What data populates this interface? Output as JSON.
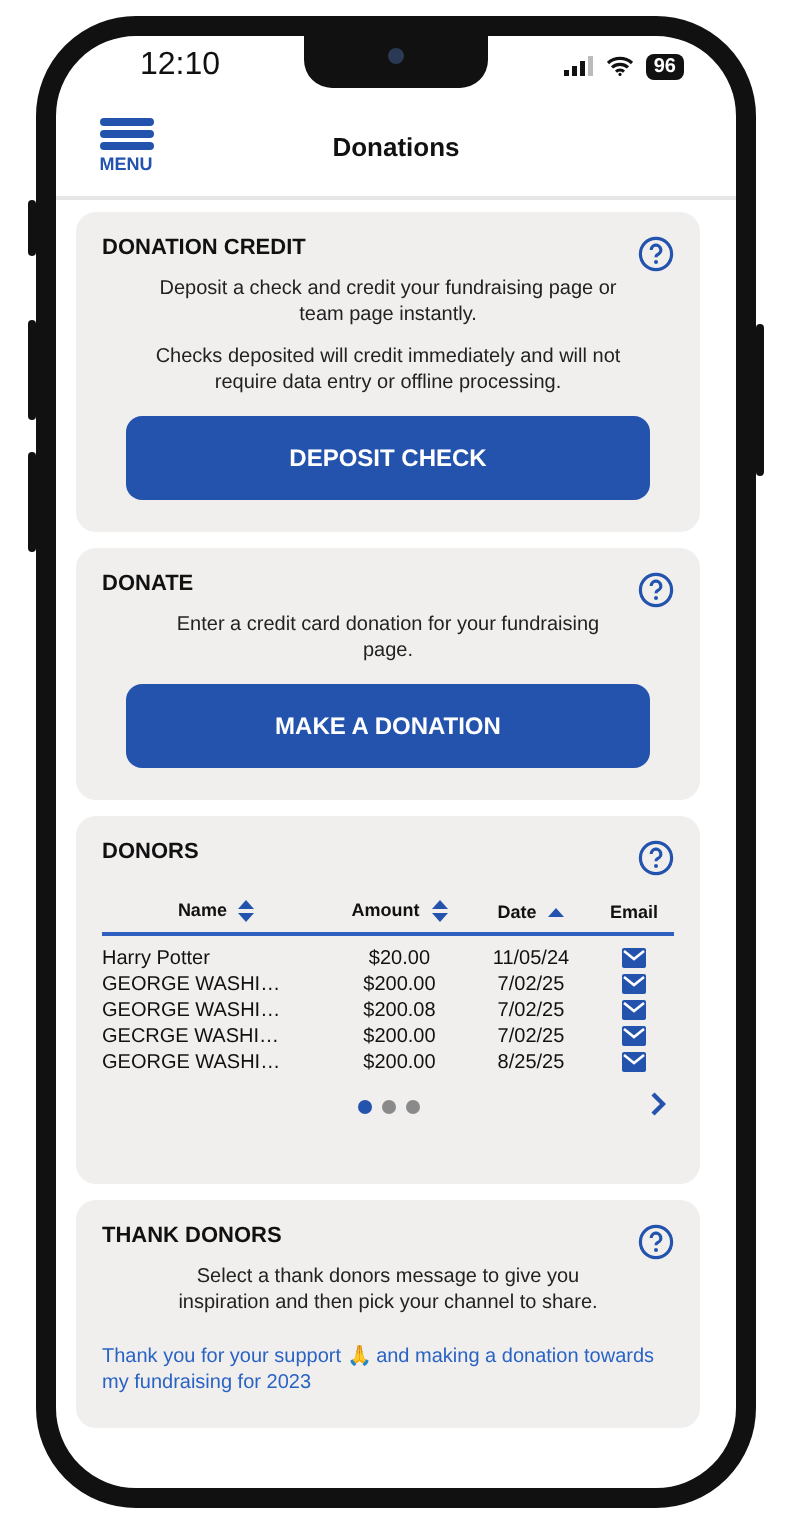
{
  "status_bar": {
    "time": "12:10",
    "battery": "96"
  },
  "header": {
    "menu_label": "MENU",
    "title": "Donations"
  },
  "cards": [
    {
      "kind": "action",
      "title": "DONATION CREDIT",
      "paragraphs": [
        "Deposit a check and credit your fundraising page or team page instantly.",
        "Checks deposited will credit immediately and will not require data entry or offline processing."
      ],
      "button": "DEPOSIT CHECK"
    },
    {
      "kind": "action",
      "title": "DONATE",
      "paragraphs": [
        "Enter a credit card donation for your fundraising page."
      ],
      "button": "MAKE A DONATION"
    },
    {
      "kind": "table",
      "title": "DONORS",
      "columns": [
        {
          "label": "Name",
          "sortable": true,
          "sorted": false
        },
        {
          "label": "Amount",
          "sortable": true,
          "sorted": false
        },
        {
          "label": "Date",
          "sortable": true,
          "sorted": true
        },
        {
          "label": "Email",
          "sortable": false
        }
      ],
      "rows": [
        {
          "name": "Harry Potter",
          "amount": "$20.00",
          "date": "11/05/24"
        },
        {
          "name": "GEORGE WASHI…",
          "amount": "$200.00",
          "date": "7/02/25"
        },
        {
          "name": "GEORGE WASHI…",
          "amount": "$200.08",
          "date": "7/02/25"
        },
        {
          "name": "GECRGE WASHI…",
          "amount": "$200.00",
          "date": "7/02/25"
        },
        {
          "name": "GEORGE WASHI…",
          "amount": "$200.00",
          "date": "8/25/25"
        }
      ],
      "pages": [
        {
          "selected": true
        },
        {
          "selected": false
        },
        {
          "selected": false
        }
      ]
    },
    {
      "kind": "message",
      "title": "THANK DONORS",
      "paragraphs": [
        "Select a thank donors message to give you inspiration and then pick your channel to share."
      ],
      "message": "Thank you for your support 🙏 and making a donation towards my fundraising for 2023"
    }
  ]
}
